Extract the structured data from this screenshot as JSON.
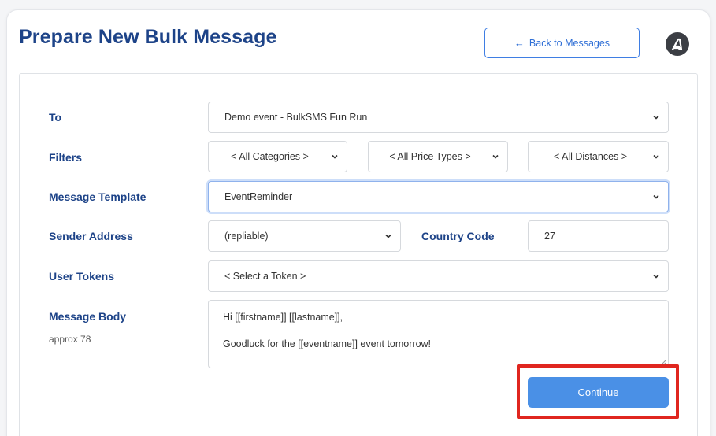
{
  "header": {
    "title": "Prepare New Bulk Message",
    "back_button_label": "Back to Messages",
    "back_arrow": "←"
  },
  "form": {
    "to": {
      "label": "To",
      "value": "Demo event - BulkSMS Fun Run"
    },
    "filters": {
      "label": "Filters",
      "categories": "< All Categories >",
      "price_types": "< All Price Types >",
      "distances": "< All Distances >"
    },
    "template": {
      "label": "Message Template",
      "value": "EventReminder"
    },
    "sender": {
      "label": "Sender Address",
      "value": "(repliable)"
    },
    "country": {
      "label": "Country Code",
      "value": "27"
    },
    "tokens": {
      "label": "User Tokens",
      "value": "< Select a Token >"
    },
    "body": {
      "label": "Message Body",
      "approx": "approx 78",
      "line1": "Hi [[firstname]] [[lastname]],",
      "line2": "Goodluck for the [[eventname]] event tomorrow!"
    },
    "continue_label": "Continue"
  },
  "colors": {
    "primary_text": "#1d4388",
    "accent": "#4a90e6",
    "highlight": "#e0261f"
  },
  "icons": {
    "avatar": "brand-logo-icon",
    "select": "chevron-down-icon"
  }
}
